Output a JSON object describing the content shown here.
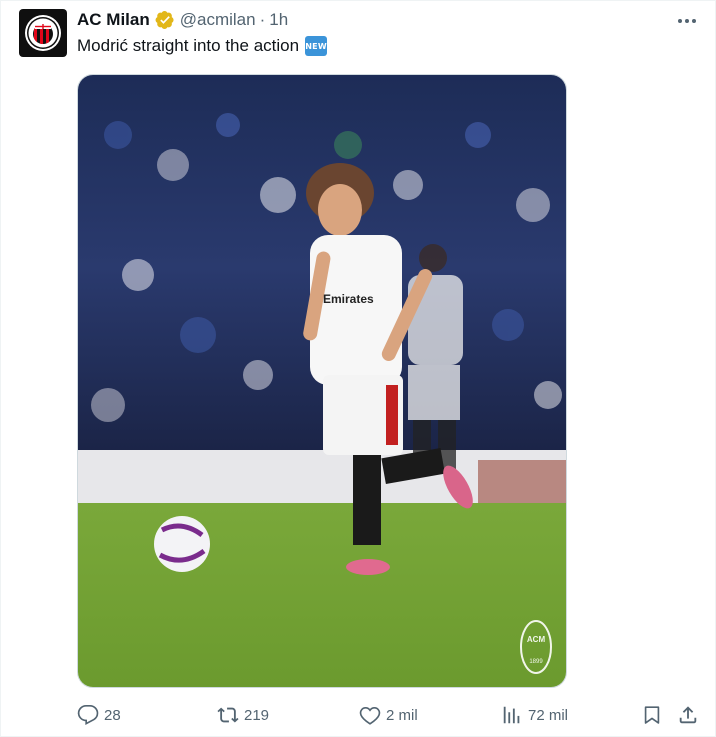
{
  "tweet": {
    "author_name": "AC Milan",
    "handle": "@acmilan",
    "separator": "·",
    "time": "1h",
    "text": "Modrić straight into the action",
    "badge": "NEW"
  },
  "avatar": {
    "logo_text": "ACM",
    "year": "1899"
  },
  "media": {
    "crest_text": "ACM",
    "crest_year": "1899"
  },
  "actions": {
    "replies": "28",
    "reposts": "219",
    "likes": "2 mil",
    "views": "72 mil"
  },
  "colors": {
    "verified": "#e2b719",
    "muted": "#536471",
    "new_badge": "#3b94d9",
    "milan_red": "#e2061a"
  },
  "icons": [
    "verified-badge-icon",
    "more-icon",
    "reply-icon",
    "repost-icon",
    "like-icon",
    "views-icon",
    "bookmark-icon",
    "share-icon"
  ]
}
